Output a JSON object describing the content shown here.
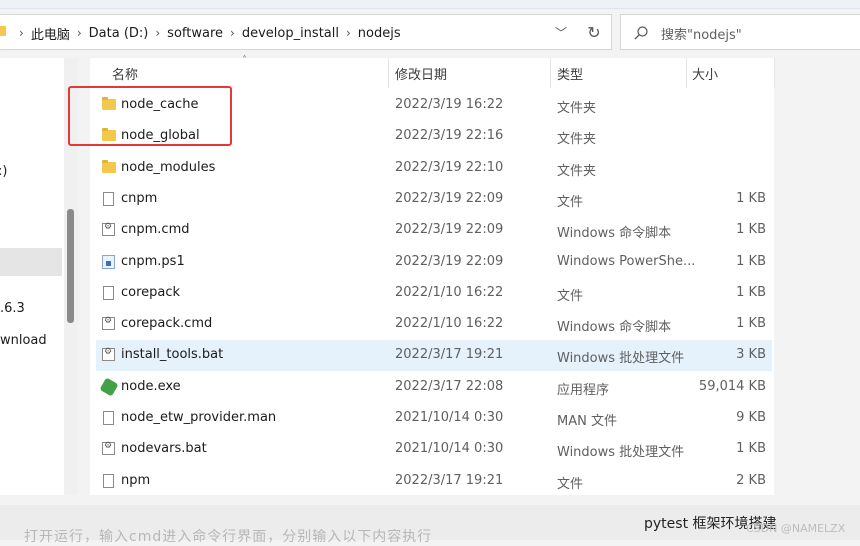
{
  "address_bar": {
    "breadcrumbs": [
      "此电脑",
      "Data (D:)",
      "software",
      "develop_install",
      "nodejs"
    ]
  },
  "search": {
    "placeholder": "搜索\"nodejs\""
  },
  "nav_pane": {
    "items": [
      {
        "label": ":)"
      },
      {
        "label": ".6.3"
      },
      {
        "label": "wnload"
      }
    ]
  },
  "columns": {
    "name": "名称",
    "modified": "修改日期",
    "type": "类型",
    "size": "大小"
  },
  "files": [
    {
      "name": "node_cache",
      "date": "2022/3/19 16:22",
      "type": "文件夹",
      "size": "",
      "icon": "folder-icon"
    },
    {
      "name": "node_global",
      "date": "2022/3/19 22:16",
      "type": "文件夹",
      "size": "",
      "icon": "folder-icon"
    },
    {
      "name": "node_modules",
      "date": "2022/3/19 22:10",
      "type": "文件夹",
      "size": "",
      "icon": "folder-icon"
    },
    {
      "name": "cnpm",
      "date": "2022/3/19 22:09",
      "type": "文件",
      "size": "1 KB",
      "icon": "file-icon"
    },
    {
      "name": "cnpm.cmd",
      "date": "2022/3/19 22:09",
      "type": "Windows 命令脚本",
      "size": "1 KB",
      "icon": "cmd-script-icon"
    },
    {
      "name": "cnpm.ps1",
      "date": "2022/3/19 22:09",
      "type": "Windows PowerShe...",
      "size": "1 KB",
      "icon": "powershell-script-icon"
    },
    {
      "name": "corepack",
      "date": "2022/1/10 16:22",
      "type": "文件",
      "size": "1 KB",
      "icon": "file-icon"
    },
    {
      "name": "corepack.cmd",
      "date": "2022/1/10 16:22",
      "type": "Windows 命令脚本",
      "size": "1 KB",
      "icon": "cmd-script-icon"
    },
    {
      "name": "install_tools.bat",
      "date": "2022/3/17 19:21",
      "type": "Windows 批处理文件",
      "size": "3 KB",
      "icon": "batch-file-icon",
      "selected": true
    },
    {
      "name": "node.exe",
      "date": "2022/3/17 22:08",
      "type": "应用程序",
      "size": "59,014 KB",
      "icon": "nodejs-exe-icon"
    },
    {
      "name": "node_etw_provider.man",
      "date": "2021/10/14 0:30",
      "type": "MAN 文件",
      "size": "9 KB",
      "icon": "file-icon"
    },
    {
      "name": "nodevars.bat",
      "date": "2021/10/14 0:30",
      "type": "Windows 批处理文件",
      "size": "1 KB",
      "icon": "batch-file-icon"
    },
    {
      "name": "npm",
      "date": "2022/3/17 19:21",
      "type": "文件",
      "size": "2 KB",
      "icon": "file-icon"
    }
  ],
  "bottom": {
    "blurred_text": "打开运行，输入cmd进入命令行界面，分别输入以下内容执行",
    "title": "pytest 框架环境搭建",
    "watermark": "CSDN @NAMELZX"
  },
  "colors": {
    "annotation_box": "#e53935",
    "selected_row": "#e5f1fb",
    "folder": "#f2c94c"
  }
}
